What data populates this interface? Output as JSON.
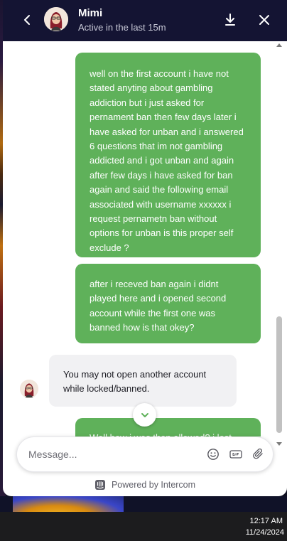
{
  "header": {
    "agent_name": "Mimi",
    "status": "Active in the last 15m"
  },
  "messages": [
    {
      "from": "user",
      "text": "well on the first account i have not stated anyting about gambling addiction but i just asked for pernament ban then few days later i have asked for unban and i answered 6 questions that im not gambling addicted and i got unban and again after few days i have asked for ban again and said the following email associated with username xxxxxx i request pernametn ban without options for unban is this proper self exclude ?"
    },
    {
      "from": "user",
      "text": "after i receved ban again i didnt played here and i opened second account while the first one was banned how is that okey?"
    },
    {
      "from": "agent",
      "text": "You may not open another account while locked/banned."
    },
    {
      "from": "user",
      "text": "Well how i was then allowed? i lost"
    }
  ],
  "composer": {
    "placeholder": "Message..."
  },
  "footer": {
    "powered_by": "Powered by Intercom"
  },
  "taskbar": {
    "time": "12:17 AM",
    "date": "11/24/2024"
  },
  "icons": {
    "back": "chevron-left-icon",
    "download": "download-icon",
    "close": "close-icon",
    "jump": "chevron-down-icon",
    "emoji": "smiley-icon",
    "gif": "gif-icon",
    "attach": "paperclip-icon",
    "brand": "intercom-logo-icon"
  },
  "colors": {
    "header_bg": "#141433",
    "user_bubble": "#5fb15a",
    "agent_bubble": "#f1f1f3"
  }
}
